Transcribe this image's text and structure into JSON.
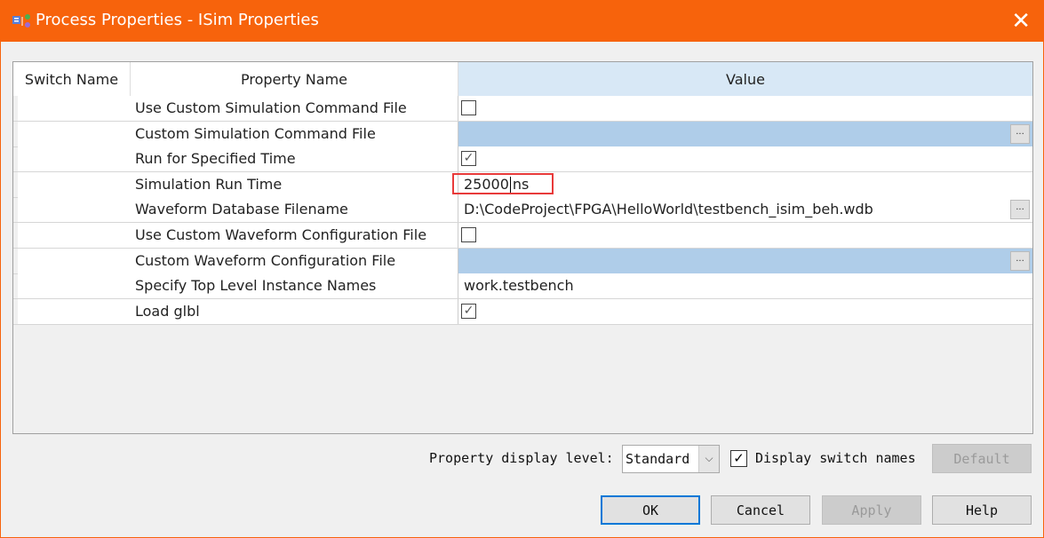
{
  "window": {
    "title": "Process Properties - ISim Properties",
    "accent": "#f7630c"
  },
  "table": {
    "headers": [
      "Switch Name",
      "Property Name",
      "Value"
    ],
    "rows": [
      {
        "switch": "",
        "property": "Use Custom Simulation Command File",
        "type": "checkbox",
        "checked": false
      },
      {
        "switch": "",
        "property": "Custom Simulation Command File",
        "type": "file",
        "value": "",
        "selected": true
      },
      {
        "switch": "",
        "property": "Run for Specified Time",
        "type": "checkbox",
        "checked": true
      },
      {
        "switch": "",
        "property": "Simulation Run Time",
        "type": "text",
        "value": "25000",
        "unit": "ns",
        "highlighted": true
      },
      {
        "switch": "",
        "property": "Waveform Database Filename",
        "type": "file",
        "value": "D:\\CodeProject\\FPGA\\HelloWorld\\testbench_isim_beh.wdb"
      },
      {
        "switch": "",
        "property": "Use Custom Waveform Configuration File",
        "type": "checkbox",
        "checked": false
      },
      {
        "switch": "",
        "property": "Custom Waveform Configuration File",
        "type": "file",
        "value": "",
        "selected": true
      },
      {
        "switch": "",
        "property": "Specify Top Level Instance Names",
        "type": "text",
        "value": "work.testbench"
      },
      {
        "switch": "",
        "property": "Load glbl",
        "type": "checkbox",
        "checked": true
      }
    ]
  },
  "footer": {
    "display_level_label": "Property display level:",
    "display_level_value": "Standard",
    "display_switch_label": "Display switch names",
    "display_switch_checked": true,
    "default_label": "Default",
    "ok_label": "OK",
    "cancel_label": "Cancel",
    "apply_label": "Apply",
    "help_label": "Help"
  },
  "browse_label": "..."
}
